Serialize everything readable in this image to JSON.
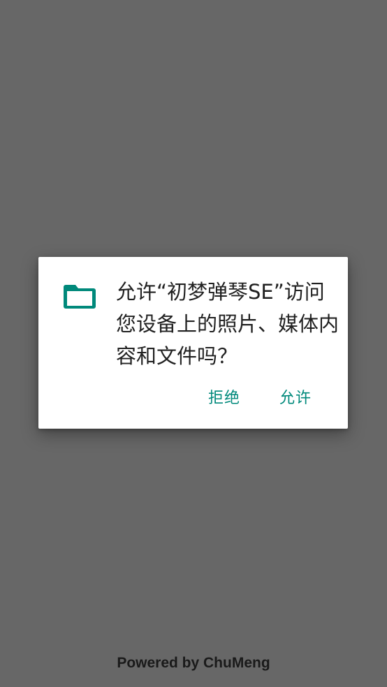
{
  "dialog": {
    "icon": "folder-icon",
    "message": "允许“初梦弹琴SE”访问您设备上的照片、媒体内容和文件吗？",
    "deny_label": "拒绝",
    "allow_label": "允许",
    "accent_color": "#00897b"
  },
  "footer": {
    "text": "Powered by ChuMeng"
  }
}
